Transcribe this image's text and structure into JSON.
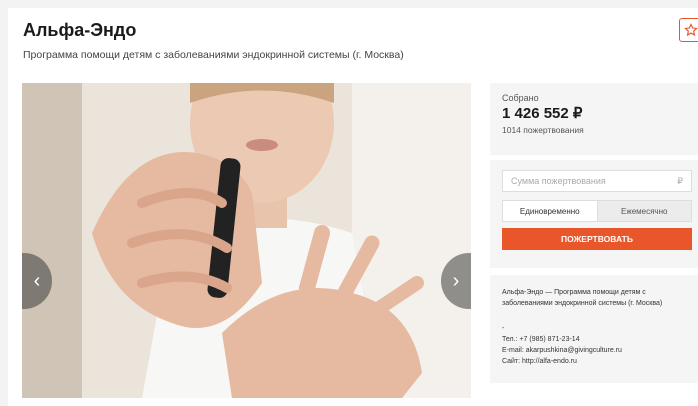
{
  "header": {
    "title": "Альфа-Эндо",
    "subtitle": "Программа помощи детям с заболеваниями эндокринной системы (г. Москва)"
  },
  "gallery": {
    "prev_label": "‹",
    "next_label": "›"
  },
  "raised": {
    "label": "Собрано",
    "amount": "1 426 552 ₽",
    "count": "1014 пожертвования"
  },
  "donate": {
    "amount_placeholder": "Сумма пожертвования",
    "currency": "₽",
    "one_time": "Единовременно",
    "monthly": "Ежемесячно",
    "button": "ПОЖЕРТВОВАТЬ"
  },
  "info": {
    "description": "Альфа-Эндо — Программа помощи детям с заболеваниями эндокринной системы (г. Москва)",
    "dash": "-",
    "phone": "Тел.: +7 (985) 871-23-14",
    "email": "E-mail: akarpushkina@givingculture.ru",
    "site": "Сайт: http://alfa-endo.ru"
  },
  "colors": {
    "accent": "#e8562a"
  }
}
